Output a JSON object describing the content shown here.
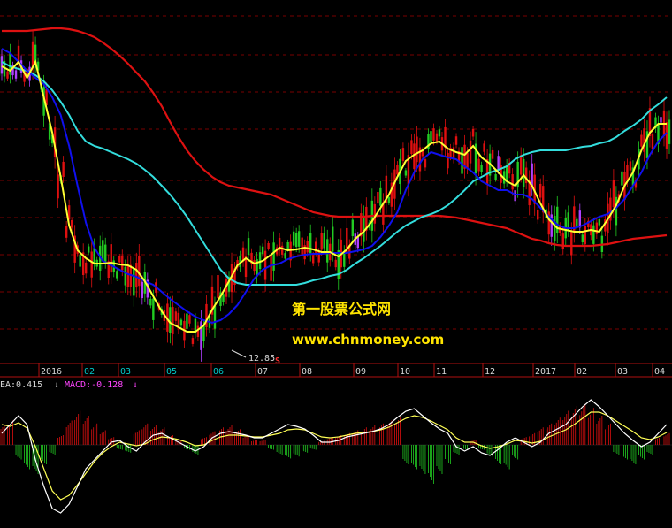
{
  "chart_data": [
    {
      "type": "candlestick",
      "x_ticks": [
        {
          "label": "2016",
          "color": "#d8d8d8"
        },
        {
          "label": "02",
          "color": "#00c8c8"
        },
        {
          "label": "03",
          "color": "#00c8c8"
        },
        {
          "label": "05",
          "color": "#00c8c8"
        },
        {
          "label": "06",
          "color": "#00c8c8"
        },
        {
          "label": "07",
          "color": "#d8d8d8"
        },
        {
          "label": "08",
          "color": "#d8d8d8"
        },
        {
          "label": "09",
          "color": "#d8d8d8"
        },
        {
          "label": "10",
          "color": "#d8d8d8"
        },
        {
          "label": "11",
          "color": "#d8d8d8"
        },
        {
          "label": "12",
          "color": "#d8d8d8"
        },
        {
          "label": "2017",
          "color": "#d8d8d8"
        },
        {
          "label": "02",
          "color": "#d8d8d8"
        },
        {
          "label": "03",
          "color": "#d8d8d8"
        },
        {
          "label": "04",
          "color": "#d8d8d8"
        }
      ],
      "low_marker": {
        "label": "12.85",
        "flag": "S"
      },
      "ma_lines": {
        "yellow": [
          75,
          80,
          70,
          88,
          70,
          110,
          150,
          200,
          255,
          283,
          292,
          298,
          298,
          297,
          299,
          300,
          305,
          318,
          335,
          352,
          365,
          370,
          375,
          375,
          368,
          350,
          335,
          318,
          300,
          292,
          298,
          295,
          288,
          280,
          283,
          282,
          280,
          282,
          285,
          285,
          290,
          282,
          270,
          262,
          250,
          235,
          220,
          200,
          182,
          175,
          170,
          162,
          160,
          168,
          172,
          175,
          165,
          178,
          185,
          195,
          205,
          210,
          198,
          210,
          230,
          248,
          258,
          260,
          262,
          262,
          260,
          262,
          248,
          232,
          210,
          195,
          170,
          150,
          140,
          140
        ],
        "blue": [
          55,
          60,
          70,
          80,
          88,
          95,
          110,
          130,
          165,
          210,
          252,
          280,
          295,
          300,
          305,
          310,
          313,
          318,
          322,
          330,
          338,
          345,
          352,
          358,
          362,
          365,
          362,
          355,
          345,
          330,
          315,
          305,
          300,
          298,
          293,
          290,
          288,
          287,
          287,
          286,
          286,
          286,
          284,
          282,
          278,
          268,
          255,
          240,
          215,
          195,
          180,
          172,
          175,
          178,
          180,
          188,
          195,
          205,
          210,
          215,
          215,
          220,
          220,
          225,
          235,
          245,
          254,
          258,
          258,
          255,
          250,
          245,
          242,
          235,
          225,
          210,
          195,
          175,
          160,
          150
        ],
        "cyan": [
          70,
          75,
          78,
          80,
          85,
          92,
          102,
          115,
          130,
          148,
          160,
          165,
          168,
          172,
          176,
          180,
          185,
          192,
          200,
          210,
          220,
          232,
          245,
          260,
          275,
          290,
          305,
          315,
          320,
          322,
          322,
          322,
          322,
          322,
          322,
          322,
          320,
          317,
          315,
          312,
          310,
          305,
          298,
          292,
          285,
          278,
          270,
          262,
          255,
          250,
          245,
          242,
          238,
          232,
          224,
          215,
          205,
          200,
          195,
          192,
          188,
          180,
          175,
          172,
          170,
          170,
          170,
          170,
          168,
          166,
          165,
          162,
          160,
          155,
          148,
          142,
          135,
          125,
          118,
          110
        ],
        "red": [
          35,
          35,
          35,
          35,
          34,
          33,
          32,
          32,
          33,
          35,
          38,
          42,
          48,
          55,
          63,
          72,
          82,
          92,
          105,
          120,
          138,
          155,
          170,
          182,
          192,
          200,
          206,
          210,
          212,
          214,
          216,
          218,
          220,
          224,
          228,
          232,
          236,
          240,
          242,
          244,
          245,
          245,
          245,
          245,
          244,
          244,
          244,
          244,
          244,
          244,
          244,
          244,
          244,
          245,
          246,
          248,
          250,
          252,
          254,
          256,
          258,
          262,
          266,
          270,
          272,
          275,
          277,
          278,
          278,
          278,
          278,
          277,
          276,
          274,
          272,
          270,
          269,
          268,
          267,
          266
        ]
      },
      "price_range_px": "plotted in screen units",
      "indicator": {
        "dea_label": "EA:0.415",
        "macd_label": "MACD:-0.128",
        "arrow": "↓",
        "dif": [
          490,
          480,
          470,
          480,
          520,
          550,
          575,
          580,
          570,
          550,
          530,
          520,
          510,
          500,
          498,
          505,
          510,
          500,
          492,
          490,
          495,
          500,
          505,
          510,
          505,
          495,
          490,
          488,
          490,
          492,
          495,
          495,
          490,
          485,
          480,
          482,
          485,
          492,
          500,
          500,
          498,
          494,
          492,
          490,
          488,
          485,
          480,
          472,
          465,
          462,
          470,
          478,
          485,
          490,
          505,
          510,
          505,
          512,
          515,
          508,
          500,
          495,
          500,
          505,
          500,
          490,
          485,
          480,
          470,
          460,
          452,
          460,
          470,
          480,
          490,
          498,
          505,
          500,
          490,
          480
        ],
        "dea": [
          480,
          482,
          478,
          484,
          505,
          530,
          555,
          565,
          560,
          548,
          535,
          522,
          512,
          505,
          500,
          502,
          504,
          502,
          497,
          494,
          495,
          497,
          500,
          504,
          503,
          498,
          494,
          492,
          492,
          493,
          494,
          494,
          492,
          490,
          486,
          485,
          486,
          490,
          494,
          495,
          494,
          492,
          490,
          489,
          488,
          486,
          483,
          478,
          473,
          470,
          472,
          476,
          481,
          486,
          495,
          500,
          500,
          504,
          507,
          505,
          502,
          498,
          499,
          501,
          499,
          494,
          490,
          486,
          480,
          473,
          466,
          466,
          470,
          476,
          482,
          488,
          495,
          497,
          494,
          489
        ],
        "hist": [
          20,
          25,
          -15,
          -25,
          -30,
          -20,
          -10,
          10,
          25,
          35,
          30,
          22,
          15,
          8,
          -5,
          -8,
          15,
          22,
          20,
          18,
          10,
          5,
          -5,
          -10,
          8,
          14,
          18,
          20,
          16,
          10,
          5,
          5,
          -5,
          -10,
          -14,
          -12,
          -8,
          -5,
          4,
          8,
          10,
          12,
          15,
          18,
          20,
          22,
          25,
          28,
          -20,
          -25,
          -30,
          -40,
          -30,
          -20,
          -10,
          -5,
          5,
          -5,
          -12,
          -20,
          -25,
          -15,
          8,
          12,
          18,
          22,
          28,
          35,
          40,
          42,
          38,
          30,
          22,
          -10,
          -15,
          -20,
          -15,
          -10,
          8,
          12
        ]
      }
    }
  ],
  "watermark": {
    "line1": "第一股票公式网",
    "line2": "www.chnmoney.com"
  },
  "colors": {
    "background": "#000000",
    "grid": "#7a0000",
    "ma_yellow": "#ffff33",
    "ma_blue": "#1010ee",
    "ma_cyan": "#33dddd",
    "ma_red": "#dd1111",
    "candle_up": "#e01010",
    "candle_down": "#22cc22",
    "candle_cool": "#b040ff",
    "axis_bar": "#b01010",
    "indicator_label": "#d8d8d8",
    "macd_label": "#ff44ff"
  }
}
